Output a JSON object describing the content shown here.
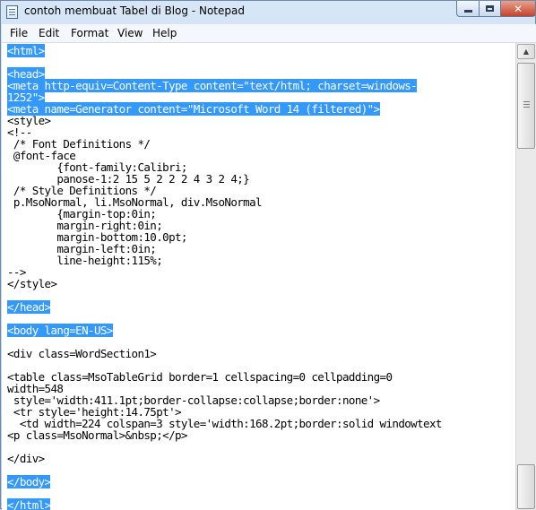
{
  "window": {
    "title": "contoh membuat Tabel di Blog - Notepad",
    "close_glyph": "✕"
  },
  "menu": [
    "File",
    "Edit",
    "Format",
    "View",
    "Help"
  ],
  "icons": {
    "app": "notepad-icon",
    "minimize": "minimize-icon",
    "maximize": "maximize-icon",
    "close": "close-icon",
    "scroll_up": "scroll-up-arrow-icon"
  },
  "colors": {
    "selection": "#3399ff",
    "close_button": "#c4432b"
  },
  "editor": {
    "lines": [
      {
        "text": "<html>",
        "selected": true
      },
      {
        "text": "",
        "selected": false
      },
      {
        "text": "<head>",
        "selected": true
      },
      {
        "text": "<meta http-equiv=Content-Type content=\"text/html; charset=windows-",
        "selected": true
      },
      {
        "text": "1252\">",
        "selected": true
      },
      {
        "text": "<meta name=Generator content=\"Microsoft Word 14 (filtered)\">",
        "selected": true
      },
      {
        "text": "<style>",
        "selected": false
      },
      {
        "text": "<!--",
        "selected": false
      },
      {
        "text": " /* Font Definitions */",
        "selected": false
      },
      {
        "text": " @font-face",
        "selected": false
      },
      {
        "text": "        {font-family:Calibri;",
        "selected": false
      },
      {
        "text": "        panose-1:2 15 5 2 2 2 4 3 2 4;}",
        "selected": false
      },
      {
        "text": " /* Style Definitions */",
        "selected": false
      },
      {
        "text": " p.MsoNormal, li.MsoNormal, div.MsoNormal",
        "selected": false
      },
      {
        "text": "        {margin-top:0in;",
        "selected": false
      },
      {
        "text": "        margin-right:0in;",
        "selected": false
      },
      {
        "text": "        margin-bottom:10.0pt;",
        "selected": false
      },
      {
        "text": "        margin-left:0in;",
        "selected": false
      },
      {
        "text": "        line-height:115%;",
        "selected": false
      },
      {
        "text": "-->",
        "selected": false
      },
      {
        "text": "</style>",
        "selected": false
      },
      {
        "text": "",
        "selected": false
      },
      {
        "text": "</head>",
        "selected": true
      },
      {
        "text": "",
        "selected": false
      },
      {
        "text": "<body lang=EN-US>",
        "selected": true
      },
      {
        "text": "",
        "selected": false
      },
      {
        "text": "<div class=WordSection1>",
        "selected": false
      },
      {
        "text": "",
        "selected": false
      },
      {
        "text": "<table class=MsoTableGrid border=1 cellspacing=0 cellpadding=0",
        "selected": false
      },
      {
        "text": "width=548",
        "selected": false
      },
      {
        "text": " style='width:411.1pt;border-collapse:collapse;border:none'>",
        "selected": false
      },
      {
        "text": " <tr style='height:14.75pt'>",
        "selected": false
      },
      {
        "text": "  <td width=224 colspan=3 style='width:168.2pt;border:solid windowtext",
        "selected": false
      },
      {
        "text": "<p class=MsoNormal>&nbsp;</p>",
        "selected": false
      },
      {
        "text": "",
        "selected": false
      },
      {
        "text": "</div>",
        "selected": false
      },
      {
        "text": "",
        "selected": false
      },
      {
        "text": "</body>",
        "selected": true
      },
      {
        "text": "",
        "selected": false
      },
      {
        "text": "</html>",
        "selected": true
      }
    ]
  }
}
